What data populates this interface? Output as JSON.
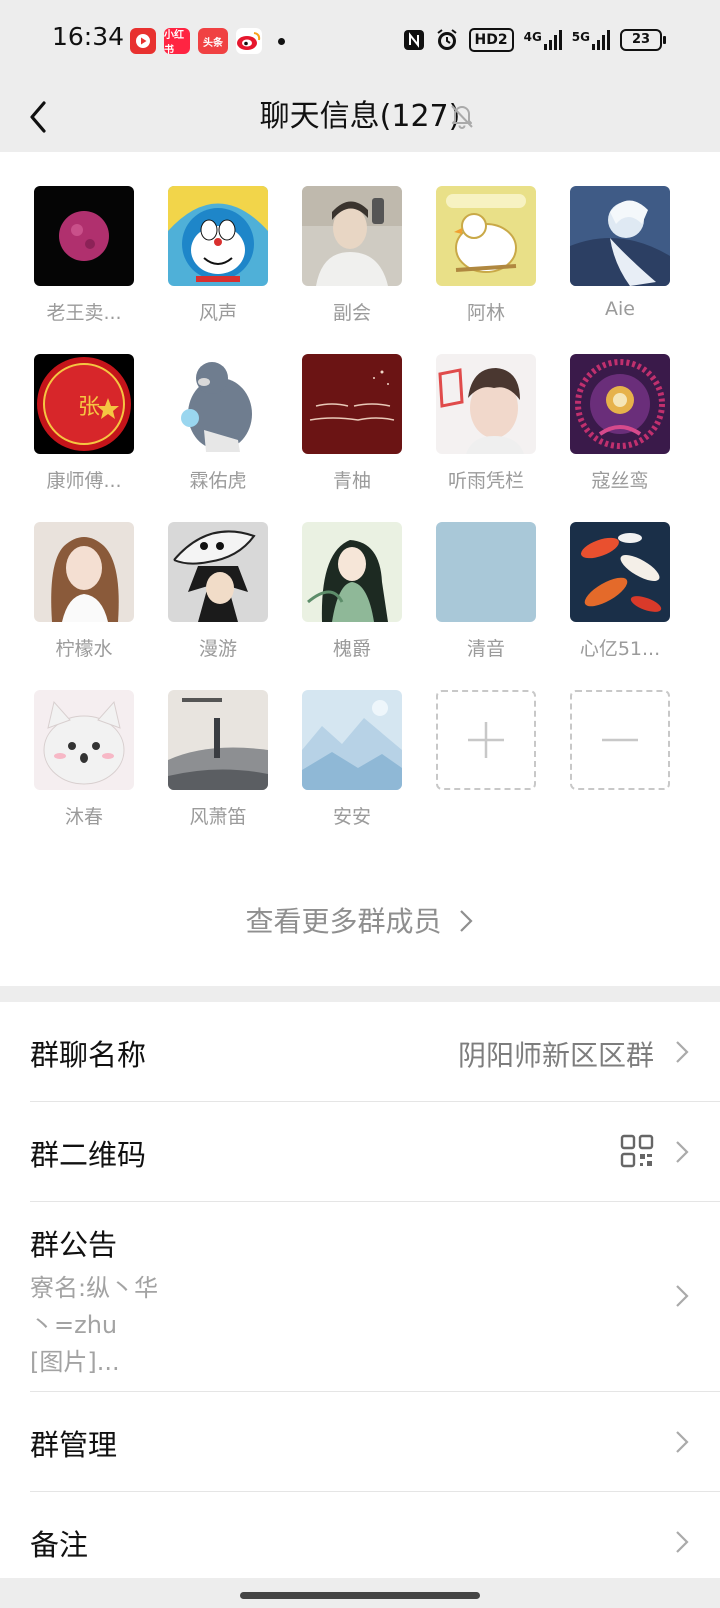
{
  "status_bar": {
    "time": "16:34",
    "app_icons": [
      {
        "name": "video-app-icon",
        "label": "",
        "color": "#e8312f"
      },
      {
        "name": "xiaohongshu-app-icon",
        "label": "小红书",
        "color": "#ff2442"
      },
      {
        "name": "toutiao-app-icon",
        "label": "头条",
        "color": "#f04142"
      },
      {
        "name": "weibo-app-icon",
        "label": "",
        "color": "#f9c13b"
      }
    ],
    "network_hd": "HD2",
    "signal_1": "4G",
    "signal_2": "5G",
    "battery": "23"
  },
  "nav": {
    "title": "聊天信息(127)"
  },
  "members": [
    {
      "name": "老王卖..."
    },
    {
      "name": "风声"
    },
    {
      "name": "副会"
    },
    {
      "name": "阿林"
    },
    {
      "name": "Aie"
    },
    {
      "name": "康师傅..."
    },
    {
      "name": "霖佑虎"
    },
    {
      "name": "青柚"
    },
    {
      "name": "听雨凭栏"
    },
    {
      "name": "寇丝鸾"
    },
    {
      "name": "柠檬水"
    },
    {
      "name": "漫游"
    },
    {
      "name": "槐爵"
    },
    {
      "name": "清音"
    },
    {
      "name": "心亿51..."
    },
    {
      "name": "沐春"
    },
    {
      "name": "风萧笛"
    },
    {
      "name": "安安"
    }
  ],
  "view_more": "查看更多群成员",
  "settings": {
    "group_name_label": "群聊名称",
    "group_name_value": "阴阳师新区区群",
    "qr_label": "群二维码",
    "notice_label": "群公告",
    "notice_lines": [
      "寮名:纵丶华",
      "丶=zhu",
      "[图片]..."
    ],
    "manage_label": "群管理",
    "remark_label": "备注"
  },
  "colors": {
    "page_bg": "#ededed",
    "card_bg": "#ffffff",
    "muted_text": "#9b9b9b"
  }
}
